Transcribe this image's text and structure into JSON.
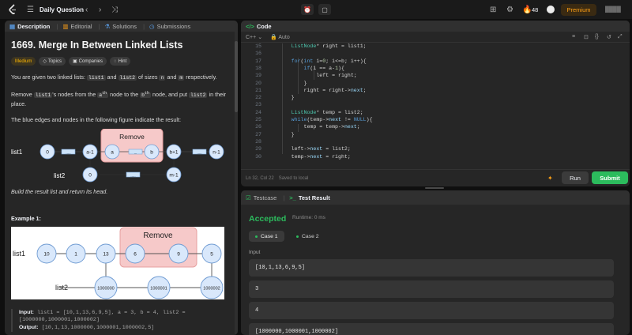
{
  "topnav": {
    "daily_label": "Daily Question",
    "streak": "48",
    "premium": "Premium"
  },
  "desc": {
    "tabs": [
      {
        "label": "Description"
      },
      {
        "label": "Editorial"
      },
      {
        "label": "Solutions"
      },
      {
        "label": "Submissions"
      }
    ],
    "title": "1669. Merge In Between Linked Lists",
    "chips": [
      "Medium",
      "Topics",
      "Companies",
      "Hint"
    ],
    "p1": {
      "a": "You are given two linked lists: ",
      "c1": "list1",
      "b": " and ",
      "c2": "list2",
      "d": " of sizes ",
      "c3": "n",
      "e": " and ",
      "c4": "m",
      "f": " respectively."
    },
    "p2": {
      "a": "Remove ",
      "c1": "list1",
      "b": "'s nodes from the ",
      "s1": "a",
      "sup1": "th",
      "c": " node to the ",
      "s2": "b",
      "sup2": "th",
      "d": " node, and put ",
      "c2": "list2",
      "e": " in their place."
    },
    "p3": "The blue edges and nodes in the following figure indicate the result:",
    "fig1": {
      "remove": "Remove",
      "list1": "list1",
      "list2": "list2",
      "n0": "0",
      "dots": ".....",
      "na1": "a-1",
      "na": "a",
      "ndots": "...",
      "nb": "b",
      "nb1": "b+1",
      "nn1": "n-1",
      "m0": "0",
      "mm1": "m-1"
    },
    "p4": "Build the result list and return its head.",
    "example": "Example 1:",
    "fig2": {
      "remove": "Remove",
      "list1": "list1",
      "list2": "list2",
      "l1": [
        "10",
        "1",
        "13",
        "6",
        "9",
        "5"
      ],
      "l2": [
        "1000000",
        "1000001",
        "1000002"
      ]
    },
    "input_label": "Input:",
    "input_value": " list1 = [10,1,13,6,9,5], a = 3, b = 4, list2 = [1000000,1000001,1000002]",
    "output_label": "Output:",
    "output_value": " [10,1,13,1000000,1000001,1000002,5]"
  },
  "code": {
    "tab": "Code",
    "lang": "C++",
    "mode": "Auto",
    "footer_pos": "Ln 32, Col 22",
    "footer_saved": "Saved to local",
    "run": "Run",
    "submit": "Submit"
  },
  "result": {
    "tab_testcase": "Testcase",
    "tab_result": "Test Result",
    "status": "Accepted",
    "runtime": "Runtime: 0 ms",
    "cases": [
      "Case 1",
      "Case 2"
    ],
    "input_label": "Input",
    "values": [
      "[10,1,13,6,9,5]",
      "3",
      "4",
      "[1000000,1000001,1000002]"
    ]
  }
}
